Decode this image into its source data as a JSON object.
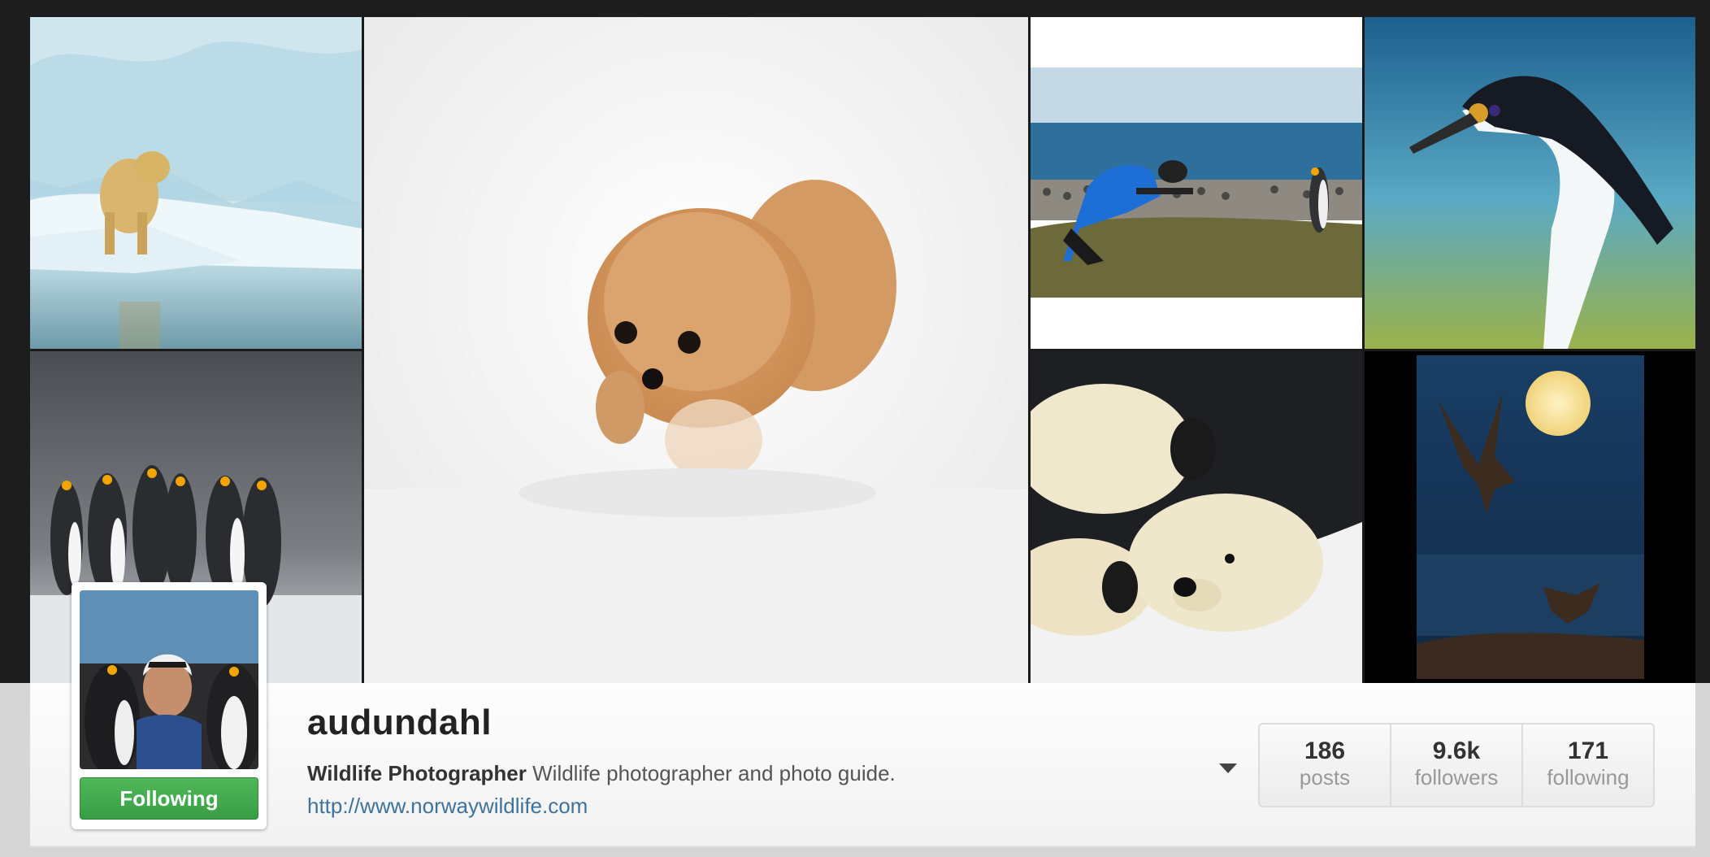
{
  "profile": {
    "username": "audundahl",
    "role": "Wildlife Photographer",
    "bio": "Wildlife photographer and photo guide.",
    "website": "http://www.norwaywildlife.com",
    "follow_label": "Following",
    "follow_color": "#3fa84a"
  },
  "stats": [
    {
      "value": "186",
      "label": "posts"
    },
    {
      "value": "9.6k",
      "label": "followers"
    },
    {
      "value": "171",
      "label": "following"
    }
  ],
  "icons": {
    "dropdown": "caret-down-icon"
  },
  "colors": {
    "link": "#3f729b",
    "page_bg": "#1d1d1d"
  }
}
